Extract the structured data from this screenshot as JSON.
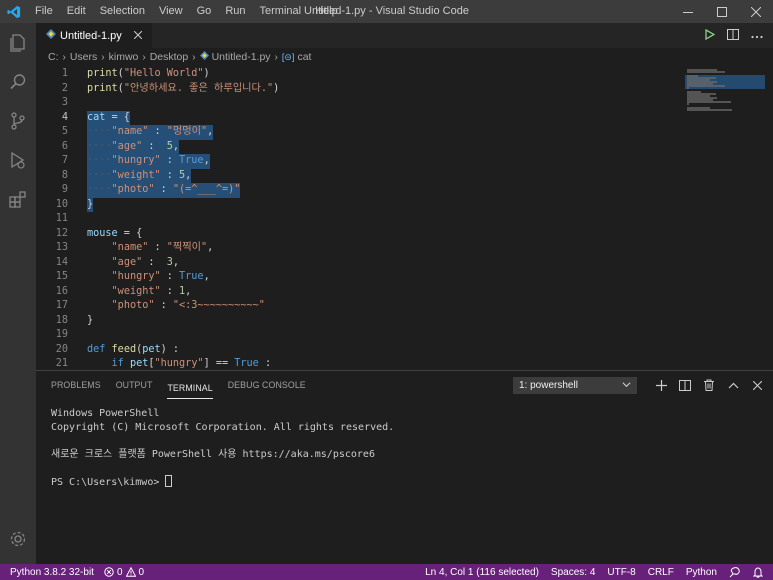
{
  "window": {
    "title": "Untitled-1.py - Visual Studio Code",
    "menu": [
      "File",
      "Edit",
      "Selection",
      "View",
      "Go",
      "Run",
      "Terminal",
      "Help"
    ]
  },
  "colors": {
    "accent": "#68217a",
    "selection": "#264f78",
    "activity_bar": "#333333",
    "title_bar": "#3c3c3c"
  },
  "activity_icons": [
    "explorer-icon",
    "search-icon",
    "source-control-icon",
    "run-debug-icon",
    "extensions-icon",
    "gear-icon"
  ],
  "tab": {
    "label": "Untitled-1.py"
  },
  "breadcrumb": [
    "C:",
    "Users",
    "kimwo",
    "Desktop",
    "Untitled-1.py",
    "cat"
  ],
  "editor": {
    "lines": [
      {
        "n": "1",
        "tokens": [
          [
            "fn",
            "print"
          ],
          [
            "txt",
            "("
          ],
          [
            "str",
            "\"Hello World\""
          ],
          [
            "txt",
            ")"
          ]
        ]
      },
      {
        "n": "2",
        "tokens": [
          [
            "fn",
            "print"
          ],
          [
            "txt",
            "("
          ],
          [
            "str",
            "\"안녕하세요. 좋은 하루입니다.\""
          ],
          [
            "txt",
            ")"
          ]
        ]
      },
      {
        "n": "3",
        "tokens": []
      },
      {
        "n": "4",
        "tokens": [
          [
            "var",
            "cat"
          ],
          [
            "txt",
            " = {"
          ]
        ],
        "sel": true
      },
      {
        "n": "5",
        "tokens": [
          [
            "ws",
            "····"
          ],
          [
            "str",
            "\"name\""
          ],
          [
            "txt",
            " : "
          ],
          [
            "str",
            "\"멍멍이\""
          ],
          [
            "txt",
            ","
          ]
        ],
        "sel": true
      },
      {
        "n": "6",
        "tokens": [
          [
            "ws",
            "····"
          ],
          [
            "str",
            "\"age\""
          ],
          [
            "txt",
            " :  "
          ],
          [
            "num",
            "5"
          ],
          [
            "txt",
            ","
          ]
        ],
        "sel": true
      },
      {
        "n": "7",
        "tokens": [
          [
            "ws",
            "····"
          ],
          [
            "str",
            "\"hungry\""
          ],
          [
            "txt",
            " : "
          ],
          [
            "kw",
            "True"
          ],
          [
            "txt",
            ","
          ]
        ],
        "sel": true
      },
      {
        "n": "8",
        "tokens": [
          [
            "ws",
            "····"
          ],
          [
            "str",
            "\"weight\""
          ],
          [
            "txt",
            " : "
          ],
          [
            "num",
            "5"
          ],
          [
            "txt",
            ","
          ]
        ],
        "sel": true
      },
      {
        "n": "9",
        "tokens": [
          [
            "ws",
            "····"
          ],
          [
            "str",
            "\"photo\""
          ],
          [
            "txt",
            " : "
          ],
          [
            "str",
            "\"(=^___^=)\""
          ]
        ],
        "sel": true
      },
      {
        "n": "10",
        "tokens": [
          [
            "txt",
            "}"
          ]
        ],
        "sel": true
      },
      {
        "n": "11",
        "tokens": []
      },
      {
        "n": "12",
        "tokens": [
          [
            "var",
            "mouse"
          ],
          [
            "txt",
            " = {"
          ]
        ]
      },
      {
        "n": "13",
        "tokens": [
          [
            "txt",
            "    "
          ],
          [
            "str",
            "\"name\""
          ],
          [
            "txt",
            " : "
          ],
          [
            "str",
            "\"찍찍이\""
          ],
          [
            "txt",
            ","
          ]
        ]
      },
      {
        "n": "14",
        "tokens": [
          [
            "txt",
            "    "
          ],
          [
            "str",
            "\"age\""
          ],
          [
            "txt",
            " :  "
          ],
          [
            "num",
            "3"
          ],
          [
            "txt",
            ","
          ]
        ]
      },
      {
        "n": "15",
        "tokens": [
          [
            "txt",
            "    "
          ],
          [
            "str",
            "\"hungry\""
          ],
          [
            "txt",
            " : "
          ],
          [
            "kw",
            "True"
          ],
          [
            "txt",
            ","
          ]
        ]
      },
      {
        "n": "16",
        "tokens": [
          [
            "txt",
            "    "
          ],
          [
            "str",
            "\"weight\""
          ],
          [
            "txt",
            " : "
          ],
          [
            "num",
            "1"
          ],
          [
            "txt",
            ","
          ]
        ]
      },
      {
        "n": "17",
        "tokens": [
          [
            "txt",
            "    "
          ],
          [
            "str",
            "\"photo\""
          ],
          [
            "txt",
            " : "
          ],
          [
            "str",
            "\"<:3~~~~~~~~~~\""
          ]
        ]
      },
      {
        "n": "18",
        "tokens": [
          [
            "txt",
            "}"
          ]
        ]
      },
      {
        "n": "19",
        "tokens": []
      },
      {
        "n": "20",
        "tokens": [
          [
            "kw",
            "def"
          ],
          [
            "txt",
            " "
          ],
          [
            "fn",
            "feed"
          ],
          [
            "txt",
            "("
          ],
          [
            "var",
            "pet"
          ],
          [
            "txt",
            ") :"
          ]
        ]
      },
      {
        "n": "21",
        "tokens": [
          [
            "txt",
            "    "
          ],
          [
            "kw",
            "if"
          ],
          [
            "txt",
            " "
          ],
          [
            "var",
            "pet"
          ],
          [
            "txt",
            "["
          ],
          [
            "str",
            "\"hungry\""
          ],
          [
            "txt",
            "] == "
          ],
          [
            "kw",
            "True"
          ],
          [
            "txt",
            " :"
          ]
        ]
      }
    ],
    "active_line": "4"
  },
  "panel": {
    "tabs": [
      "PROBLEMS",
      "OUTPUT",
      "TERMINAL",
      "DEBUG CONSOLE"
    ],
    "active_tab": "TERMINAL",
    "terminal_select": "1: powershell",
    "terminal_lines": [
      "Windows PowerShell",
      "Copyright (C) Microsoft Corporation. All rights reserved.",
      "",
      "새로운 크로스 플랫폼 PowerShell 사용 https://aka.ms/pscore6",
      ""
    ],
    "prompt": "PS C:\\Users\\kimwo> "
  },
  "status": {
    "python": "Python 3.8.2 32-bit",
    "errors": "0",
    "warnings": "0",
    "position": "Ln 4, Col 1 (116 selected)",
    "spaces": "Spaces: 4",
    "encoding": "UTF-8",
    "eol": "CRLF",
    "language": "Python"
  }
}
